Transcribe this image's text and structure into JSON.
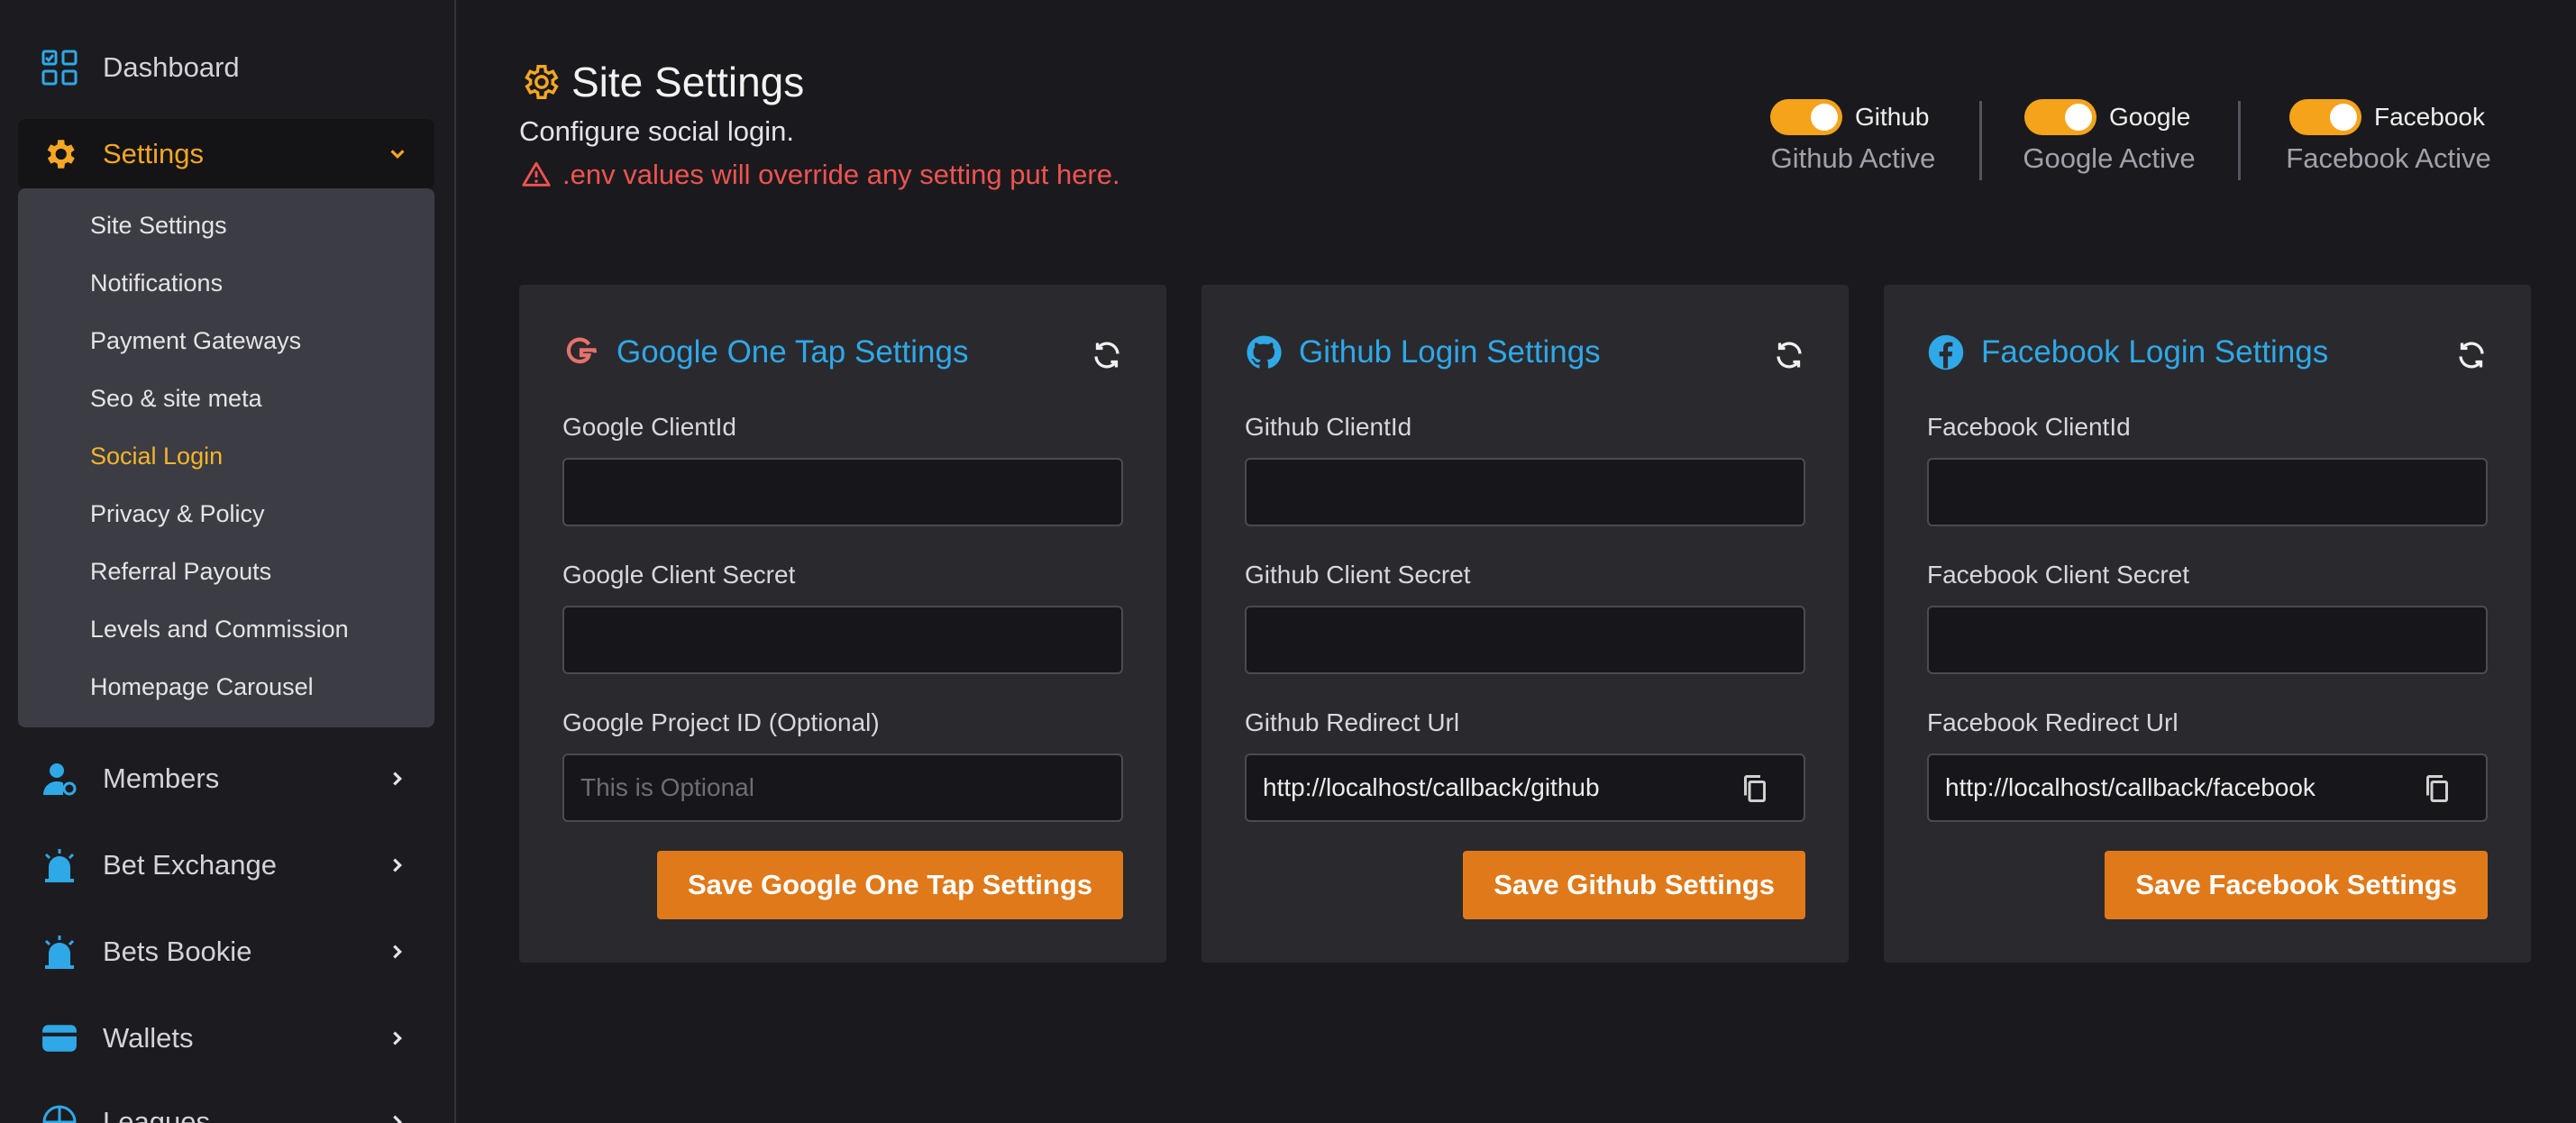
{
  "sidebar": {
    "items": [
      {
        "label": "Dashboard",
        "icon": "dashboard-grid-icon"
      },
      {
        "label": "Settings",
        "icon": "gear-icon"
      },
      {
        "label": "Members",
        "icon": "user-gear-icon"
      },
      {
        "label": "Bet Exchange",
        "icon": "alarm-siren-icon"
      },
      {
        "label": "Bets Bookie",
        "icon": "alarm-siren-icon"
      },
      {
        "label": "Wallets",
        "icon": "wallet-icon"
      },
      {
        "label": "Leagues",
        "icon": "ball-icon"
      }
    ],
    "submenu": [
      "Site Settings",
      "Notifications",
      "Payment Gateways",
      "Seo & site meta",
      "Social Login",
      "Privacy & Policy",
      "Referral Payouts",
      "Levels and Commission",
      "Homepage Carousel"
    ],
    "active_submenu": "Social Login"
  },
  "header": {
    "title": "Site Settings",
    "subtitle": "Configure social login.",
    "warning": ".env values will override any setting put here."
  },
  "toggles": [
    {
      "label": "Github",
      "status": "Github Active",
      "on": true
    },
    {
      "label": "Google",
      "status": "Google Active",
      "on": true
    },
    {
      "label": "Facebook",
      "status": "Facebook Active",
      "on": true
    }
  ],
  "cards": {
    "google": {
      "title": "Google One Tap Settings",
      "client_id_label": "Google ClientId",
      "client_id_value": "",
      "client_secret_label": "Google Client Secret",
      "client_secret_value": "",
      "project_label": "Google Project ID (Optional)",
      "project_placeholder": "This is Optional",
      "save_label": "Save Google One Tap Settings"
    },
    "github": {
      "title": "Github Login Settings",
      "client_id_label": "Github ClientId",
      "client_id_value": "",
      "client_secret_label": "Github Client Secret",
      "client_secret_value": "",
      "redirect_label": "Github Redirect Url",
      "redirect_value": "http://localhost/callback/github",
      "save_label": "Save Github Settings"
    },
    "facebook": {
      "title": "Facebook Login Settings",
      "client_id_label": "Facebook ClientId",
      "client_id_value": "",
      "client_secret_label": "Facebook Client Secret",
      "client_secret_value": "",
      "redirect_label": "Facebook Redirect Url",
      "redirect_value": "http://localhost/callback/facebook",
      "save_label": "Save Facebook Settings"
    }
  },
  "colors": {
    "accent": "#f5a623",
    "title_blue": "#2fa8e8",
    "button": "#e0791a",
    "warning": "#ef5350"
  }
}
